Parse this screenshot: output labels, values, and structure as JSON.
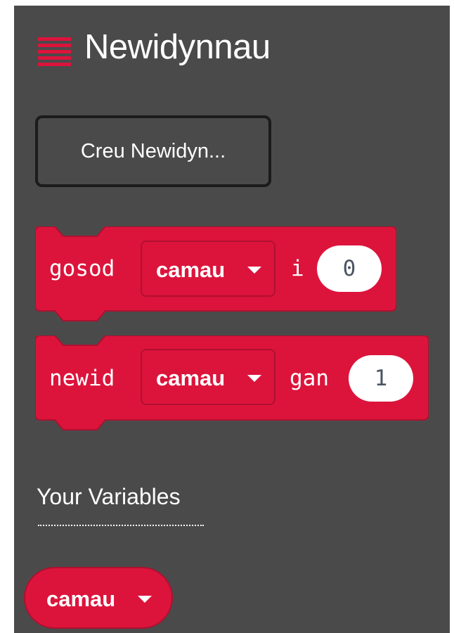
{
  "header": {
    "icon": "hamburger-icon",
    "title": "Newidynnau",
    "accent_color": "#dc143c",
    "background_color": "#4b4a4b"
  },
  "create_button": {
    "label": "Creu Newidyn..."
  },
  "blocks": [
    {
      "keyword": "gosod",
      "variable": "camau",
      "connector": "i",
      "value": "0"
    },
    {
      "keyword": "newid",
      "variable": "camau",
      "connector": "gan",
      "value": "1"
    }
  ],
  "variables_section": {
    "title": "Your Variables",
    "items": [
      {
        "name": "camau"
      }
    ]
  }
}
